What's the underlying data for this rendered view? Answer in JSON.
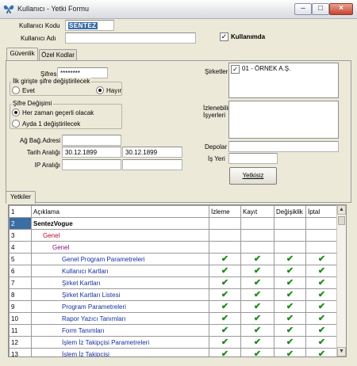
{
  "window": {
    "title": "Kullanıcı - Yetki Formu",
    "minimize": "–",
    "maximize": "□",
    "close": "×"
  },
  "header": {
    "user_code_label": "Kullanıcı Kodu",
    "user_code_value": "SENTEZ",
    "user_name_label": "Kullanıcı Adı",
    "user_name_value": "",
    "in_use_label": "Kullanımda",
    "in_use_checked": true
  },
  "tabs": [
    {
      "label": "Güvenlik"
    },
    {
      "label": "Özel Kodlar"
    }
  ],
  "security": {
    "password_label": "Şifresi",
    "password_value": "********",
    "first_login_group": "İlk girişte şifre değiştirilecek",
    "first_login_options": [
      "Evet",
      "Hayır"
    ],
    "first_login_selected": "Hayır",
    "password_change_group": "Şifre Değişimi",
    "password_change_options": [
      "Her zaman geçerli olacak",
      "Ayda 1 değiştirilecek"
    ],
    "password_change_selected": "Her zaman geçerli olacak",
    "network_address_label": "Ağ Bağ.Adresi",
    "network_address_value": "",
    "date_range_label": "Tarih Aralığı",
    "date_from": "30.12.1899",
    "date_to": "30.12.1899",
    "ip_range_label": "IP Aralığı",
    "ip_from": "",
    "ip_to": "",
    "companies_label": "Şirketler",
    "companies": [
      {
        "label": "01 - ÖRNEK A.Ş.",
        "checked": true
      }
    ],
    "allowed_workplaces_label": "İzlenebilir İşyerleri",
    "warehouses_label": "Depolar",
    "warehouses_value": "",
    "workplace_label": "İş Yeri",
    "workplace_value": "",
    "unauthorized_button": "Yetkisiz"
  },
  "permissions": {
    "tab_label": "Yetkiler",
    "columns": [
      "Açıklama",
      "İzleme",
      "Kayıt",
      "Değişiklik",
      "İptal"
    ],
    "header_num": "1",
    "rows": [
      {
        "num": "2",
        "label": "SentezVogue",
        "indent": 0,
        "bold": true,
        "color": "#000000",
        "checks": false
      },
      {
        "num": "3",
        "label": "Genel",
        "indent": 1,
        "bold": false,
        "color": "#b01020",
        "checks": false
      },
      {
        "num": "4",
        "label": "Genel",
        "indent": 2,
        "bold": false,
        "color": "#8a1080",
        "checks": false
      },
      {
        "num": "5",
        "label": "Genel Program Parametreleri",
        "indent": 3,
        "bold": false,
        "color": "#1530a0",
        "checks": true
      },
      {
        "num": "6",
        "label": "Kullanıcı Kartları",
        "indent": 3,
        "bold": false,
        "color": "#1530a0",
        "checks": true
      },
      {
        "num": "7",
        "label": "Şirket Kartları",
        "indent": 3,
        "bold": false,
        "color": "#1530a0",
        "checks": true
      },
      {
        "num": "8",
        "label": "Şirket Kartları Listesi",
        "indent": 3,
        "bold": false,
        "color": "#1530a0",
        "checks": true
      },
      {
        "num": "9",
        "label": "Program Parametreleri",
        "indent": 3,
        "bold": false,
        "color": "#1530a0",
        "checks": true
      },
      {
        "num": "10",
        "label": "Rapor Yazıcı Tanımları",
        "indent": 3,
        "bold": false,
        "color": "#1530a0",
        "checks": true
      },
      {
        "num": "11",
        "label": "Form Tanımları",
        "indent": 3,
        "bold": false,
        "color": "#1530a0",
        "checks": true
      },
      {
        "num": "12",
        "label": "İşlem İz Takipçisi Parametreleri",
        "indent": 3,
        "bold": false,
        "color": "#1530a0",
        "checks": true
      },
      {
        "num": "13",
        "label": "İşlem İz Takipçisi",
        "indent": 3,
        "bold": false,
        "color": "#1530a0",
        "checks": true
      }
    ]
  },
  "colors": {
    "selection": "#3a6ea5",
    "check_green": "#1c8a1c"
  }
}
